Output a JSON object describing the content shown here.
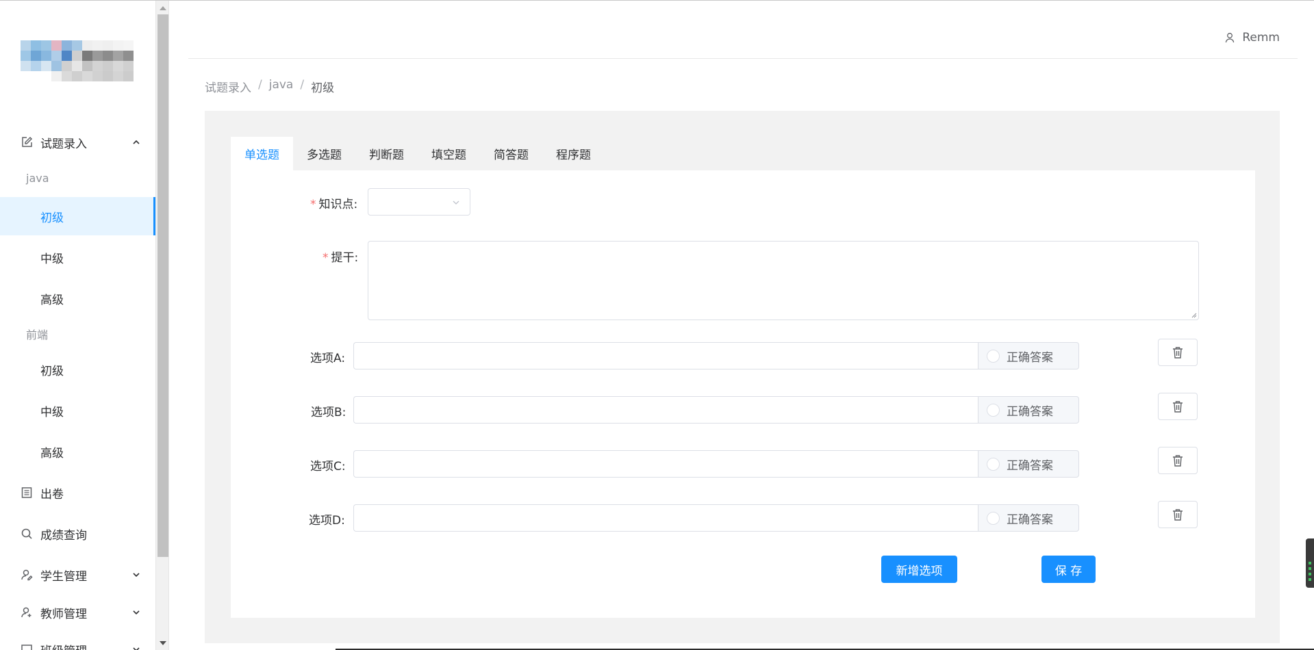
{
  "user": {
    "name": "Remm"
  },
  "sidebar": {
    "question_entry": "试题录入",
    "java_group": "java",
    "java_items": [
      "初级",
      "中级",
      "高级"
    ],
    "frontend_group": "前端",
    "frontend_items": [
      "初级",
      "中级",
      "高级"
    ],
    "paper": "出卷",
    "scores": "成绩查询",
    "students": "学生管理",
    "teachers": "教师管理",
    "classes": "班级管理",
    "accent_color": "#1890ff"
  },
  "breadcrumb": [
    "试题录入",
    "java",
    "初级"
  ],
  "breadcrumb_sep": "/",
  "tabs": [
    "单选题",
    "多选题",
    "判断题",
    "填空题",
    "简答题",
    "程序题"
  ],
  "form": {
    "knowledge_label": "知识点:",
    "stem_label": "提干:",
    "required_mark": "*",
    "knowledge_value": "",
    "stem_value": "",
    "options": [
      {
        "label": "选项A:",
        "value": "",
        "correct": "正确答案"
      },
      {
        "label": "选项B:",
        "value": "",
        "correct": "正确答案"
      },
      {
        "label": "选项C:",
        "value": "",
        "correct": "正确答案"
      },
      {
        "label": "选项D:",
        "value": "",
        "correct": "正确答案"
      }
    ],
    "add_option": "新增选项",
    "save": "保 存"
  }
}
